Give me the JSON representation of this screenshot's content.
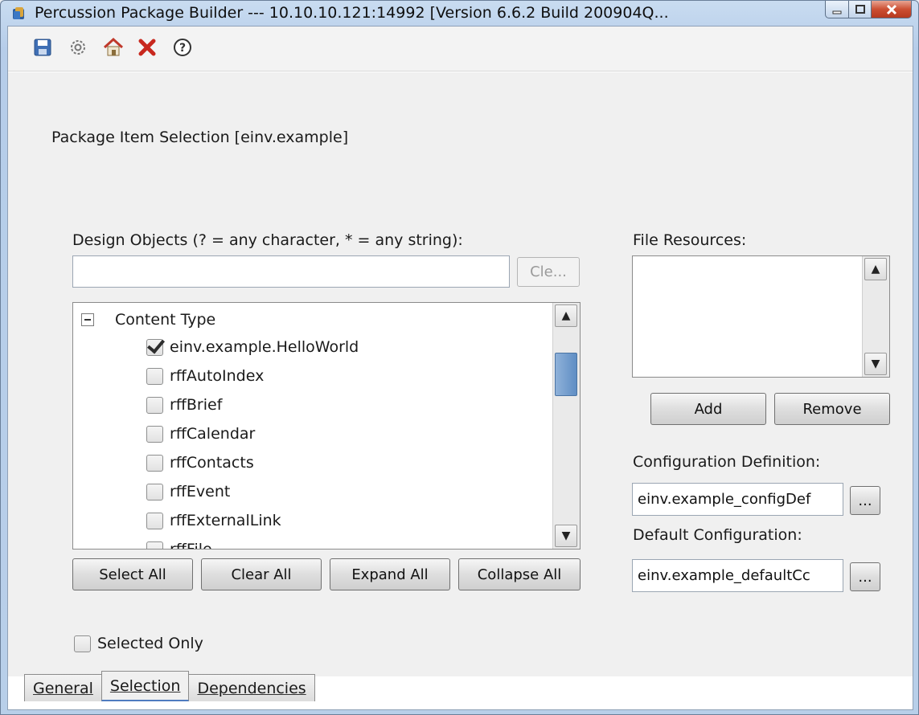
{
  "window": {
    "title": "Percussion Package Builder --- 10.10.10.121:14992 [Version 6.6.2  Build 200904Q..."
  },
  "toolbar": {
    "icons": [
      "save-icon",
      "gear-icon",
      "home-icon",
      "close-icon",
      "help-icon"
    ]
  },
  "page": {
    "title": "Package Item Selection [einv.example]"
  },
  "design_objects": {
    "label": "Design Objects (? = any character, * = any string):",
    "filter_value": "",
    "clear_label": "Cle...",
    "tree": {
      "group_label": "Content Type",
      "items": [
        {
          "label": "einv.example.HelloWorld",
          "checked": true
        },
        {
          "label": "rffAutoIndex",
          "checked": false
        },
        {
          "label": "rffBrief",
          "checked": false
        },
        {
          "label": "rffCalendar",
          "checked": false
        },
        {
          "label": "rffContacts",
          "checked": false
        },
        {
          "label": "rffEvent",
          "checked": false
        },
        {
          "label": "rffExternalLink",
          "checked": false
        },
        {
          "label": "rffFile",
          "checked": false
        }
      ]
    },
    "buttons": {
      "select_all": "Select All",
      "clear_all": "Clear All",
      "expand_all": "Expand All",
      "collapse_all": "Collapse All"
    },
    "selected_only_label": "Selected Only"
  },
  "file_resources": {
    "label": "File Resources:",
    "add_label": "Add",
    "remove_label": "Remove"
  },
  "configuration": {
    "definition_label": "Configuration Definition:",
    "definition_value": "einv.example_configDef",
    "default_label": "Default Configuration:",
    "default_value": "einv.example_defaultCc",
    "browse_label": "..."
  },
  "tabs": [
    {
      "label": "General"
    },
    {
      "label": "Selection"
    },
    {
      "label": "Dependencies"
    }
  ]
}
